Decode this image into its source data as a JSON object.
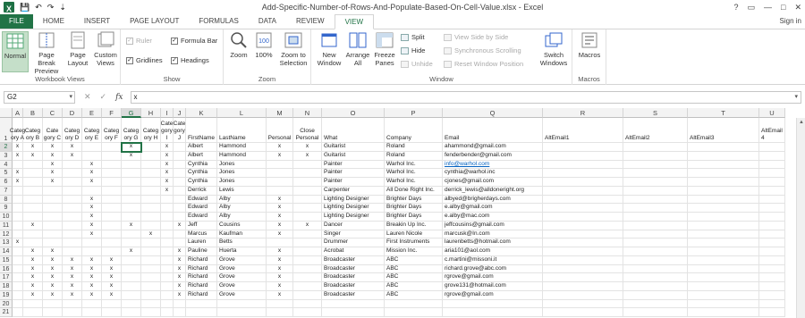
{
  "window": {
    "title": "Add-Specific-Number-of-Rows-And-Populate-Based-On-Cell-Value.xlsx - Excel",
    "qat": {
      "logo": "X",
      "save": "💾",
      "undo": "↶",
      "redo": "↷",
      "customize": "⇣"
    },
    "controls": {
      "help": "?",
      "restore": "▭",
      "minimize": "—",
      "maximize": "□",
      "close": "✕"
    }
  },
  "tabs": [
    {
      "label": "FILE"
    },
    {
      "label": "HOME"
    },
    {
      "label": "INSERT"
    },
    {
      "label": "PAGE LAYOUT"
    },
    {
      "label": "FORMULAS"
    },
    {
      "label": "DATA"
    },
    {
      "label": "REVIEW"
    },
    {
      "label": "VIEW"
    }
  ],
  "signin": "Sign in",
  "ribbon": {
    "workbook_views": {
      "label": "Workbook Views",
      "normal": "Normal",
      "page_break": "Page Break Preview",
      "page_layout": "Page Layout",
      "custom_views": "Custom Views"
    },
    "show": {
      "label": "Show",
      "ruler": "Ruler",
      "formula_bar": "Formula Bar",
      "gridlines": "Gridlines",
      "headings": "Headings",
      "check": "✓"
    },
    "zoom": {
      "label": "Zoom",
      "zoom": "Zoom",
      "hundred": "100%",
      "zoom_selection": "Zoom to Selection"
    },
    "window": {
      "label": "Window",
      "new_window": "New Window",
      "arrange_all": "Arrange All",
      "freeze_panes": "Freeze Panes",
      "split": "Split",
      "hide": "Hide",
      "unhide": "Unhide",
      "side_by_side": "View Side by Side",
      "sync_scroll": "Synchronous Scrolling",
      "reset_pos": "Reset Window Position",
      "switch_windows": "Switch Windows"
    },
    "macros": {
      "label": "Macros",
      "macros": "Macros"
    }
  },
  "formula_bar": {
    "name_box": "G2",
    "cancel": "✕",
    "enter": "✓",
    "fx": "fx",
    "value": "x",
    "dropdown": "▾"
  },
  "columns": [
    {
      "letter": "A",
      "header": "Categ ory A"
    },
    {
      "letter": "B",
      "header": "Categ ory B"
    },
    {
      "letter": "C",
      "header": "Cate gory C"
    },
    {
      "letter": "D",
      "header": "Categ ory D"
    },
    {
      "letter": "E",
      "header": "Categ ory E"
    },
    {
      "letter": "F",
      "header": "Categ ory F"
    },
    {
      "letter": "G",
      "header": "Categ ory G"
    },
    {
      "letter": "H",
      "header": "Categ ory H"
    },
    {
      "letter": "I",
      "header": "Cate gory I"
    },
    {
      "letter": "J",
      "header": "Cate gory J"
    },
    {
      "letter": "K",
      "header": "FirstName"
    },
    {
      "letter": "L",
      "header": "LastName"
    },
    {
      "letter": "M",
      "header": "Personal"
    },
    {
      "letter": "N",
      "header": "Close Personal"
    },
    {
      "letter": "O",
      "header": "What"
    },
    {
      "letter": "P",
      "header": "Company"
    },
    {
      "letter": "Q",
      "header": "Email"
    },
    {
      "letter": "R",
      "header": "AltEmail1"
    },
    {
      "letter": "S",
      "header": "AltEmail2"
    },
    {
      "letter": "T",
      "header": "AltEmail3"
    },
    {
      "letter": "U",
      "header": "AltEmail 4"
    }
  ],
  "rows": [
    {
      "n": "2",
      "cells": [
        "x",
        "x",
        "x",
        "x",
        "",
        "",
        "x",
        "",
        "x",
        "",
        "Albert",
        "Hammond",
        "x",
        "x",
        "Guitarist",
        "Roland",
        "ahammond@gmail.com",
        "",
        "",
        "",
        ""
      ]
    },
    {
      "n": "3",
      "cells": [
        "x",
        "x",
        "x",
        "x",
        "",
        "",
        "x",
        "",
        "x",
        "",
        "Albert",
        "Hammond",
        "x",
        "x",
        "Guitarist",
        "Roland",
        "fenderbender@gmail.com",
        "",
        "",
        "",
        ""
      ]
    },
    {
      "n": "4",
      "cells": [
        "",
        "",
        "x",
        "",
        "x",
        "",
        "",
        "",
        "x",
        "",
        "Cynthia",
        "Jones",
        "",
        "",
        "Painter",
        "Warhol Inc.",
        "info@warhol.com",
        "",
        "",
        "",
        ""
      ]
    },
    {
      "n": "5",
      "cells": [
        "x",
        "",
        "x",
        "",
        "x",
        "",
        "",
        "",
        "x",
        "",
        "Cynthia",
        "Jones",
        "",
        "",
        "Painter",
        "Warhol Inc.",
        "cynthia@warhol.inc",
        "",
        "",
        "",
        ""
      ]
    },
    {
      "n": "6",
      "cells": [
        "x",
        "",
        "x",
        "",
        "x",
        "",
        "",
        "",
        "x",
        "",
        "Cynthia",
        "Jones",
        "",
        "",
        "Painter",
        "Warhol Inc.",
        "cjones@gmail.com",
        "",
        "",
        "",
        ""
      ]
    },
    {
      "n": "7",
      "cells": [
        "",
        "",
        "",
        "",
        "",
        "",
        "",
        "",
        "x",
        "",
        "Derrick",
        "Lewis",
        "",
        "",
        "Carpenter",
        "All Done Right Inc.",
        "derrick_lewis@alldoneright.org",
        "",
        "",
        "",
        ""
      ]
    },
    {
      "n": "8",
      "cells": [
        "",
        "",
        "",
        "",
        "x",
        "",
        "",
        "",
        "",
        "",
        "Edward",
        "Alby",
        "x",
        "",
        "Lighting Designer",
        "Brighter Days",
        "albyed@brigherdays.com",
        "",
        "",
        "",
        ""
      ]
    },
    {
      "n": "9",
      "cells": [
        "",
        "",
        "",
        "",
        "x",
        "",
        "",
        "",
        "",
        "",
        "Edward",
        "Alby",
        "x",
        "",
        "Lighting Designer",
        "Brighter Days",
        "e.alby@gmail.com",
        "",
        "",
        "",
        ""
      ]
    },
    {
      "n": "10",
      "cells": [
        "",
        "",
        "",
        "",
        "x",
        "",
        "",
        "",
        "",
        "",
        "Edward",
        "Alby",
        "x",
        "",
        "Lighting Designer",
        "Brighter Days",
        "e.alby@mac.com",
        "",
        "",
        "",
        ""
      ]
    },
    {
      "n": "11",
      "cells": [
        "",
        "x",
        "",
        "",
        "x",
        "",
        "x",
        "",
        "",
        "x",
        "Jeff",
        "Cousins",
        "x",
        "x",
        "Dancer",
        "Breakin Up Inc.",
        "jeffcousins@gmail.com",
        "",
        "",
        "",
        ""
      ]
    },
    {
      "n": "12",
      "cells": [
        "",
        "",
        "",
        "",
        "x",
        "",
        "",
        "x",
        "",
        "",
        "Marcus",
        "Kaufman",
        "x",
        "",
        "Singer",
        "Lauren Nicole",
        "marcusk@In.com",
        "",
        "",
        "",
        ""
      ]
    },
    {
      "n": "13",
      "cells": [
        "x",
        "",
        "",
        "",
        "",
        "",
        "",
        "",
        "",
        "",
        "Lauren",
        "Betts",
        "",
        "",
        "Drummer",
        "First Instruments",
        "laurenbetts@hotmail.com",
        "",
        "",
        "",
        ""
      ]
    },
    {
      "n": "14",
      "cells": [
        "",
        "x",
        "x",
        "",
        "",
        "",
        "x",
        "",
        "",
        "x",
        "Pauline",
        "Huerta",
        "x",
        "",
        "Acrobat",
        "Mission Inc.",
        "aria101@aol.com",
        "",
        "",
        "",
        ""
      ]
    },
    {
      "n": "15",
      "cells": [
        "",
        "x",
        "x",
        "x",
        "x",
        "x",
        "",
        "",
        "",
        "x",
        "Richard",
        "Grove",
        "x",
        "",
        "Broadcaster",
        "ABC",
        "c.martini@missoni.it",
        "",
        "",
        "",
        ""
      ]
    },
    {
      "n": "16",
      "cells": [
        "",
        "x",
        "x",
        "x",
        "x",
        "x",
        "",
        "",
        "",
        "x",
        "Richard",
        "Grove",
        "x",
        "",
        "Broadcaster",
        "ABC",
        "richard.grove@abc.com",
        "",
        "",
        "",
        ""
      ]
    },
    {
      "n": "17",
      "cells": [
        "",
        "x",
        "x",
        "x",
        "x",
        "x",
        "",
        "",
        "",
        "x",
        "Richard",
        "Grove",
        "x",
        "",
        "Broadcaster",
        "ABC",
        "rgrove@gmail.com",
        "",
        "",
        "",
        ""
      ]
    },
    {
      "n": "18",
      "cells": [
        "",
        "x",
        "x",
        "x",
        "x",
        "x",
        "",
        "",
        "",
        "x",
        "Richard",
        "Grove",
        "x",
        "",
        "Broadcaster",
        "ABC",
        "grove131@hotmail.com",
        "",
        "",
        "",
        ""
      ]
    },
    {
      "n": "19",
      "cells": [
        "",
        "x",
        "x",
        "x",
        "x",
        "x",
        "",
        "",
        "",
        "x",
        "Richard",
        "Grove",
        "x",
        "",
        "Broadcaster",
        "ABC",
        "rgrove@gmail.com",
        "",
        "",
        "",
        ""
      ]
    },
    {
      "n": "20",
      "cells": [
        "",
        "",
        "",
        "",
        "",
        "",
        "",
        "",
        "",
        "",
        "",
        "",
        "",
        "",
        "",
        "",
        "",
        "",
        "",
        "",
        ""
      ]
    },
    {
      "n": "21",
      "cells": [
        "",
        "",
        "",
        "",
        "",
        "",
        "",
        "",
        "",
        "",
        "",
        "",
        "",
        "",
        "",
        "",
        "",
        "",
        "",
        "",
        ""
      ]
    }
  ],
  "colors": {
    "excel_green": "#217346",
    "link": "#0563c1"
  }
}
